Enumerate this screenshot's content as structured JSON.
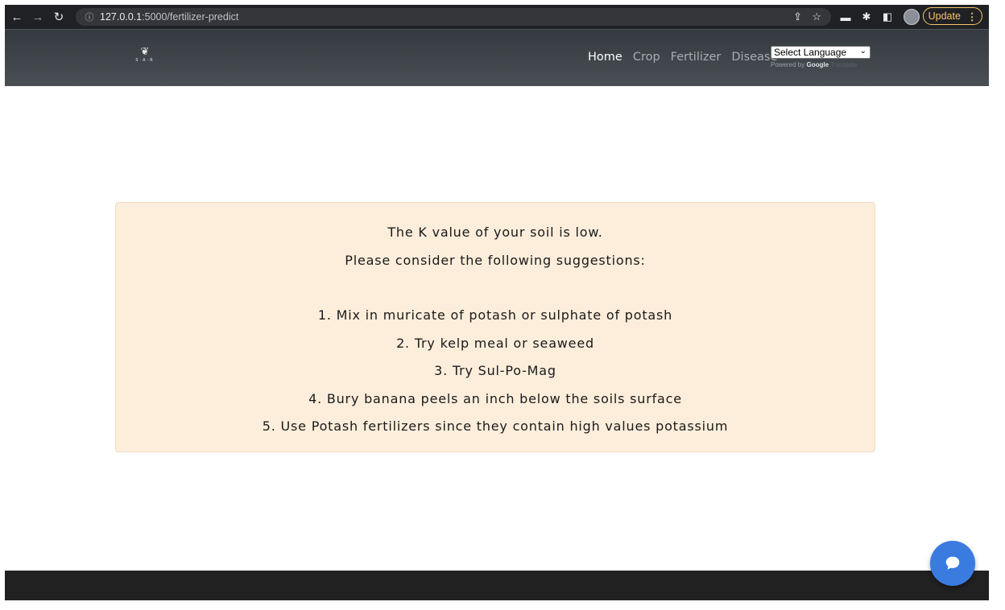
{
  "browser": {
    "url_host": "127.0.0.1",
    "url_path": ":5000/fertilizer-predict",
    "update_label": "Update"
  },
  "nav": {
    "links": [
      "Home",
      "Crop",
      "Fertilizer",
      "Disease"
    ],
    "active": "Home",
    "language_select": "Select Language",
    "powered_by": "Powered by",
    "powered_google": "Google",
    "powered_translate": "Translate",
    "logo_text": "S·A·R"
  },
  "result": {
    "heading": "The K value of your soil is low.",
    "subheading": "Please consider the following suggestions:",
    "suggestions": [
      "1. Mix in muricate of potash or sulphate of potash",
      "2. Try kelp meal or seaweed",
      "3. Try Sul-Po-Mag",
      "4. Bury banana peels an inch below the soils surface",
      "5. Use Potash fertilizers since they contain high values potassium"
    ]
  },
  "colors": {
    "navbar": "#40454a",
    "result_bg": "#fdeedb",
    "footer": "#212121",
    "chat_button": "#3a7be0"
  }
}
